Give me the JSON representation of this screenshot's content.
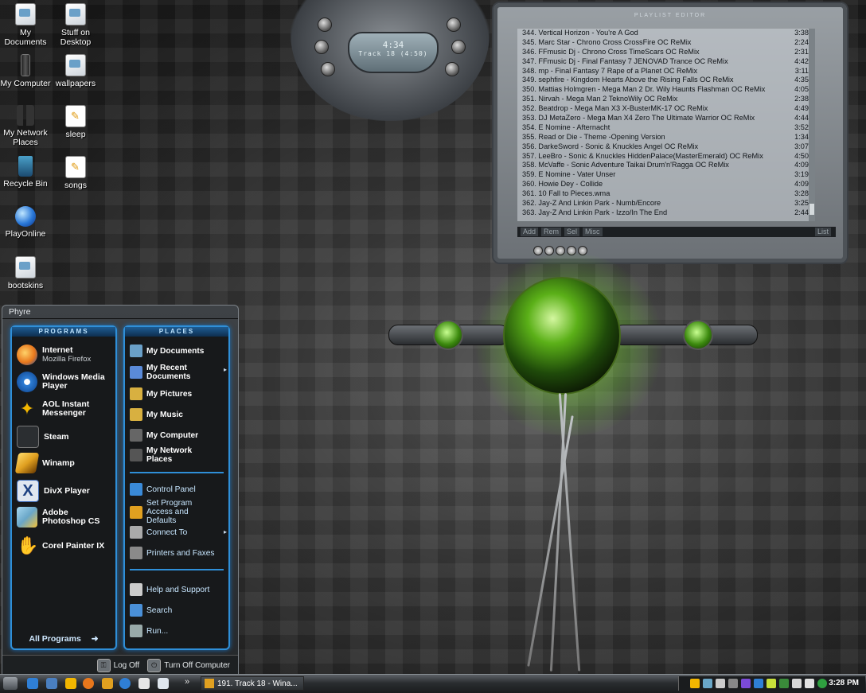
{
  "desktop": {
    "icons": [
      {
        "label": "My Documents",
        "icon": "my-documents-icon"
      },
      {
        "label": "Stuff on Desktop",
        "icon": "folder-icon"
      },
      {
        "label": "My Computer",
        "icon": "my-computer-icon"
      },
      {
        "label": "wallpapers",
        "icon": "folder-icon"
      },
      {
        "label": "My Network Places",
        "icon": "network-places-icon"
      },
      {
        "label": "sleep",
        "icon": "file-icon"
      },
      {
        "label": "Recycle Bin",
        "icon": "recycle-bin-icon"
      },
      {
        "label": "songs",
        "icon": "file-icon"
      },
      {
        "label": "PlayOnline",
        "icon": "globe-icon"
      },
      {
        "label": "bootskins",
        "icon": "folder-icon"
      }
    ]
  },
  "winamp": {
    "display_time": "4:34",
    "display_track": "Track 18 (4:50)",
    "playlist_title": "PLAYLIST EDITOR",
    "tracks": [
      {
        "title": "344. Vertical Horizon - You're A God",
        "duration": "3:38"
      },
      {
        "title": "345. Marc Star - Chrono Cross CrossFire OC ReMix",
        "duration": "2:24"
      },
      {
        "title": "346. FFmusic Dj - Chrono Cross TimeScars OC ReMix",
        "duration": "2:31"
      },
      {
        "title": "347. FFmusic Dj - Final Fantasy 7 JENOVAD Trance OC ReMix",
        "duration": "4:42"
      },
      {
        "title": "348. mp - Final Fantasy 7 Rape of a Planet OC ReMix",
        "duration": "3:11"
      },
      {
        "title": "349. sephfire - Kingdom Hearts Above the Rising Falls OC ReMix",
        "duration": "4:35"
      },
      {
        "title": "350. Mattias Holmgren - Mega Man 2 Dr. Wily Haunts Flashman OC ReMix",
        "duration": "4:05"
      },
      {
        "title": "351. Nirvah - Mega Man 2 TeknoWily OC ReMix",
        "duration": "2:38"
      },
      {
        "title": "352. Beatdrop - Mega Man X3 X-BusterMK-17 OC ReMix",
        "duration": "4:49"
      },
      {
        "title": "353. DJ MetaZero - Mega Man X4 Zero The Ultimate Warrior OC ReMix",
        "duration": "4:44"
      },
      {
        "title": "354. E Nomine - Afternacht",
        "duration": "3:52"
      },
      {
        "title": "355. Read or Die - Theme -Opening Version",
        "duration": "1:34"
      },
      {
        "title": "356. DarkeSword - Sonic & Knuckles Angel OC ReMix",
        "duration": "3:07"
      },
      {
        "title": "357. LeeBro - Sonic & Knuckles HiddenPalace(MasterEmerald) OC ReMix",
        "duration": "4:50"
      },
      {
        "title": "358. McVaffe - Sonic Adventure Taikai Drum'n'Ragga OC ReMix",
        "duration": "4:09"
      },
      {
        "title": "359. E Nomine - Vater Unser",
        "duration": "3:19"
      },
      {
        "title": "360. Howie Dey - Collide",
        "duration": "4:09"
      },
      {
        "title": "361. 10 Fall to Pieces.wma",
        "duration": "3:28"
      },
      {
        "title": "362. Jay-Z And Linkin Park - Numb/Encore",
        "duration": "3:25"
      },
      {
        "title": "363. Jay-Z And Linkin Park - Izzo/In The End",
        "duration": "2:44"
      }
    ],
    "buttons": {
      "add": "Add",
      "rem": "Rem",
      "sel": "Sel",
      "misc": "Misc",
      "list": "List"
    }
  },
  "startmenu": {
    "user": "Phyre",
    "programs_header": "PROGRAMS",
    "places_header": "PLACES",
    "programs": [
      {
        "label": "Internet",
        "sub": "Mozilla Firefox",
        "icon": "firefox-icon",
        "color": "#e8771c"
      },
      {
        "label": "Windows Media Player",
        "sub": "",
        "icon": "media-player-icon",
        "color": "#2f7fd6"
      },
      {
        "label": "AOL Instant Messenger",
        "sub": "",
        "icon": "aim-icon",
        "color": "#f2b600"
      },
      {
        "label": "Steam",
        "sub": "",
        "icon": "steam-icon",
        "color": "#3a3f44"
      },
      {
        "label": "Winamp",
        "sub": "",
        "icon": "winamp-icon",
        "color": "#e0a020"
      },
      {
        "label": "DivX Player",
        "sub": "",
        "icon": "divx-icon",
        "color": "#3b6ab8"
      },
      {
        "label": "Adobe Photoshop CS",
        "sub": "",
        "icon": "photoshop-icon",
        "color": "#6aa7c8"
      },
      {
        "label": "Corel Painter IX",
        "sub": "",
        "icon": "painter-icon",
        "color": "#e6b7a8"
      }
    ],
    "all_programs": "All Programs",
    "places": [
      {
        "label": "My Documents",
        "icon": "my-documents-icon",
        "bold": true,
        "arrow": false
      },
      {
        "label": "My Recent Documents",
        "icon": "recent-documents-icon",
        "bold": true,
        "arrow": true
      },
      {
        "label": "My Pictures",
        "icon": "my-pictures-icon",
        "bold": true,
        "arrow": false
      },
      {
        "label": "My Music",
        "icon": "my-music-icon",
        "bold": true,
        "arrow": false
      },
      {
        "label": "My Computer",
        "icon": "my-computer-icon",
        "bold": true,
        "arrow": false
      },
      {
        "label": "My Network Places",
        "icon": "network-places-icon",
        "bold": true,
        "arrow": false
      },
      {
        "label": "Control Panel",
        "icon": "control-panel-icon",
        "bold": false,
        "arrow": false
      },
      {
        "label": "Set Program Access and Defaults",
        "icon": "program-access-icon",
        "bold": false,
        "arrow": false
      },
      {
        "label": "Connect To",
        "icon": "connect-to-icon",
        "bold": false,
        "arrow": true
      },
      {
        "label": "Printers and Faxes",
        "icon": "printers-icon",
        "bold": false,
        "arrow": false
      },
      {
        "label": "Help and Support",
        "icon": "help-icon",
        "bold": false,
        "arrow": false
      },
      {
        "label": "Search",
        "icon": "search-icon",
        "bold": false,
        "arrow": false
      },
      {
        "label": "Run...",
        "icon": "run-icon",
        "bold": false,
        "arrow": false
      }
    ],
    "log_off": "Log Off",
    "turn_off": "Turn Off Computer"
  },
  "taskbar": {
    "more_indicator": "»",
    "task_label": "191. Track 18 - Wina...",
    "clock": "3:28 PM"
  },
  "colors": {
    "accent_blue": "#2f8fd8",
    "orb_green": "#7ee82a"
  }
}
